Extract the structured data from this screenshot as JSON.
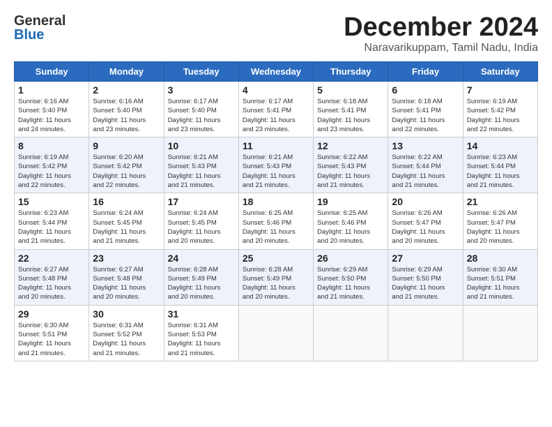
{
  "header": {
    "logo_line1": "General",
    "logo_line2": "Blue",
    "month": "December 2024",
    "location": "Naravarikuppam, Tamil Nadu, India"
  },
  "weekdays": [
    "Sunday",
    "Monday",
    "Tuesday",
    "Wednesday",
    "Thursday",
    "Friday",
    "Saturday"
  ],
  "weeks": [
    [
      {
        "day": "1",
        "info": "Sunrise: 6:16 AM\nSunset: 5:40 PM\nDaylight: 11 hours\nand 24 minutes."
      },
      {
        "day": "2",
        "info": "Sunrise: 6:16 AM\nSunset: 5:40 PM\nDaylight: 11 hours\nand 23 minutes."
      },
      {
        "day": "3",
        "info": "Sunrise: 6:17 AM\nSunset: 5:40 PM\nDaylight: 11 hours\nand 23 minutes."
      },
      {
        "day": "4",
        "info": "Sunrise: 6:17 AM\nSunset: 5:41 PM\nDaylight: 11 hours\nand 23 minutes."
      },
      {
        "day": "5",
        "info": "Sunrise: 6:18 AM\nSunset: 5:41 PM\nDaylight: 11 hours\nand 23 minutes."
      },
      {
        "day": "6",
        "info": "Sunrise: 6:18 AM\nSunset: 5:41 PM\nDaylight: 11 hours\nand 22 minutes."
      },
      {
        "day": "7",
        "info": "Sunrise: 6:19 AM\nSunset: 5:42 PM\nDaylight: 11 hours\nand 22 minutes."
      }
    ],
    [
      {
        "day": "8",
        "info": "Sunrise: 6:19 AM\nSunset: 5:42 PM\nDaylight: 11 hours\nand 22 minutes."
      },
      {
        "day": "9",
        "info": "Sunrise: 6:20 AM\nSunset: 5:42 PM\nDaylight: 11 hours\nand 22 minutes."
      },
      {
        "day": "10",
        "info": "Sunrise: 6:21 AM\nSunset: 5:43 PM\nDaylight: 11 hours\nand 21 minutes."
      },
      {
        "day": "11",
        "info": "Sunrise: 6:21 AM\nSunset: 5:43 PM\nDaylight: 11 hours\nand 21 minutes."
      },
      {
        "day": "12",
        "info": "Sunrise: 6:22 AM\nSunset: 5:43 PM\nDaylight: 11 hours\nand 21 minutes."
      },
      {
        "day": "13",
        "info": "Sunrise: 6:22 AM\nSunset: 5:44 PM\nDaylight: 11 hours\nand 21 minutes."
      },
      {
        "day": "14",
        "info": "Sunrise: 6:23 AM\nSunset: 5:44 PM\nDaylight: 11 hours\nand 21 minutes."
      }
    ],
    [
      {
        "day": "15",
        "info": "Sunrise: 6:23 AM\nSunset: 5:44 PM\nDaylight: 11 hours\nand 21 minutes."
      },
      {
        "day": "16",
        "info": "Sunrise: 6:24 AM\nSunset: 5:45 PM\nDaylight: 11 hours\nand 21 minutes."
      },
      {
        "day": "17",
        "info": "Sunrise: 6:24 AM\nSunset: 5:45 PM\nDaylight: 11 hours\nand 20 minutes."
      },
      {
        "day": "18",
        "info": "Sunrise: 6:25 AM\nSunset: 5:46 PM\nDaylight: 11 hours\nand 20 minutes."
      },
      {
        "day": "19",
        "info": "Sunrise: 6:25 AM\nSunset: 5:46 PM\nDaylight: 11 hours\nand 20 minutes."
      },
      {
        "day": "20",
        "info": "Sunrise: 6:26 AM\nSunset: 5:47 PM\nDaylight: 11 hours\nand 20 minutes."
      },
      {
        "day": "21",
        "info": "Sunrise: 6:26 AM\nSunset: 5:47 PM\nDaylight: 11 hours\nand 20 minutes."
      }
    ],
    [
      {
        "day": "22",
        "info": "Sunrise: 6:27 AM\nSunset: 5:48 PM\nDaylight: 11 hours\nand 20 minutes."
      },
      {
        "day": "23",
        "info": "Sunrise: 6:27 AM\nSunset: 5:48 PM\nDaylight: 11 hours\nand 20 minutes."
      },
      {
        "day": "24",
        "info": "Sunrise: 6:28 AM\nSunset: 5:49 PM\nDaylight: 11 hours\nand 20 minutes."
      },
      {
        "day": "25",
        "info": "Sunrise: 6:28 AM\nSunset: 5:49 PM\nDaylight: 11 hours\nand 20 minutes."
      },
      {
        "day": "26",
        "info": "Sunrise: 6:29 AM\nSunset: 5:50 PM\nDaylight: 11 hours\nand 21 minutes."
      },
      {
        "day": "27",
        "info": "Sunrise: 6:29 AM\nSunset: 5:50 PM\nDaylight: 11 hours\nand 21 minutes."
      },
      {
        "day": "28",
        "info": "Sunrise: 6:30 AM\nSunset: 5:51 PM\nDaylight: 11 hours\nand 21 minutes."
      }
    ],
    [
      {
        "day": "29",
        "info": "Sunrise: 6:30 AM\nSunset: 5:51 PM\nDaylight: 11 hours\nand 21 minutes."
      },
      {
        "day": "30",
        "info": "Sunrise: 6:31 AM\nSunset: 5:52 PM\nDaylight: 11 hours\nand 21 minutes."
      },
      {
        "day": "31",
        "info": "Sunrise: 6:31 AM\nSunset: 5:53 PM\nDaylight: 11 hours\nand 21 minutes."
      },
      {
        "day": "",
        "info": ""
      },
      {
        "day": "",
        "info": ""
      },
      {
        "day": "",
        "info": ""
      },
      {
        "day": "",
        "info": ""
      }
    ]
  ]
}
